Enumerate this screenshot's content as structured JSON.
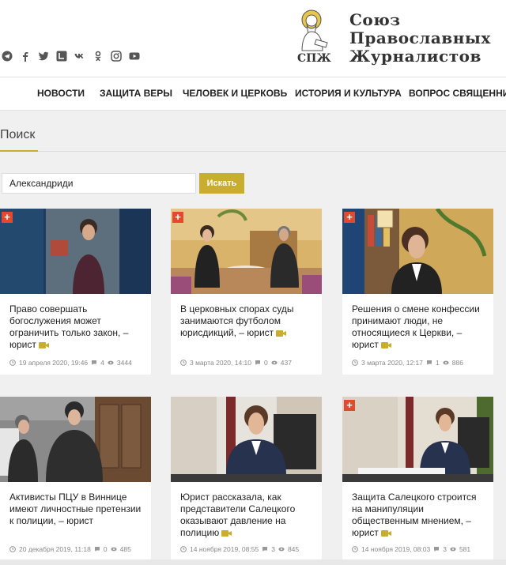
{
  "header": {
    "logo_abbr": "СПЖ",
    "logo_lines": [
      "Союз",
      "Православных",
      "Журналистов"
    ],
    "social_icons": [
      "telegram-icon",
      "facebook-icon",
      "twitter-icon",
      "livejournal-icon",
      "vk-icon",
      "odnoklassniki-icon",
      "instagram-icon",
      "youtube-icon"
    ]
  },
  "nav": {
    "items": [
      "НОВОСТИ",
      "ЗАЩИТА ВЕРЫ",
      "ЧЕЛОВЕК И ЦЕРКОВЬ",
      "ИСТОРИЯ И КУЛЬТУРА",
      "ВОПРОС СВЯЩЕННИКУ"
    ]
  },
  "search": {
    "title": "Поиск",
    "query": "Александриди",
    "button_label": "Искать"
  },
  "colors": {
    "accent": "#c9ad2f",
    "plus": "#e24a2f"
  },
  "cards": [
    {
      "title": "Право совершать богослужения может ограничить только закон, – юрист",
      "date": "19 апреля 2020, 19:46",
      "comments": "4",
      "views": "3444",
      "plus": true
    },
    {
      "title": "В церковных спорах суды занимаются футболом юрисдикций, – юрист",
      "date": "3 марта 2020, 14:10",
      "comments": "0",
      "views": "437",
      "plus": true
    },
    {
      "title": "Решения о смене конфессии принимают люди, не относящиеся к Церкви, – юрист",
      "date": "3 марта 2020, 12:17",
      "comments": "1",
      "views": "886",
      "plus": true
    },
    {
      "title": "Активисты ПЦУ в Виннице имеют личностные претензии к полиции, – юрист",
      "date": "20 декабря 2019, 11:18",
      "comments": "0",
      "views": "485",
      "plus": false
    },
    {
      "title": "Юрист рассказала, как представители Салецкого оказывают давление на полицию",
      "date": "14 ноября 2019, 08:55",
      "comments": "3",
      "views": "845",
      "plus": false
    },
    {
      "title": "Защита Салецкого строится на манипуляции общественным мнением, – юрист",
      "date": "14 ноября 2019, 08:03",
      "comments": "3",
      "views": "581",
      "plus": true
    }
  ]
}
